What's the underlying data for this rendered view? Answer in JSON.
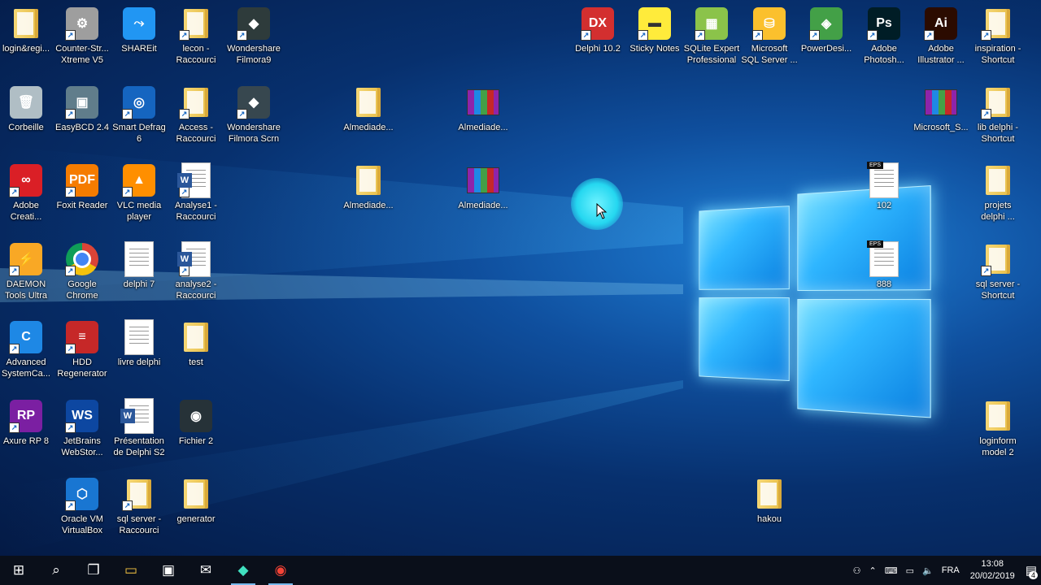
{
  "desktop": {
    "icons": [
      {
        "id": "login",
        "label": "login&regi...",
        "kind": "folder",
        "shortcut": false
      },
      {
        "id": "counter-strike",
        "label": "Counter-Str...\nXtreme V5",
        "kind": "app",
        "color": "#9e9e9e",
        "glyph": "⚙",
        "shortcut": true
      },
      {
        "id": "shareit",
        "label": "SHAREit",
        "kind": "app",
        "color": "#2196f3",
        "glyph": "⤳",
        "shortcut": false
      },
      {
        "id": "lecon",
        "label": "lecon -\nRaccourci",
        "kind": "folder",
        "shortcut": true
      },
      {
        "id": "filmora9",
        "label": "Wondershare\nFilmora9",
        "kind": "app",
        "color": "#2e3b3b",
        "glyph": "◆",
        "shortcut": true
      },
      {
        "id": "corbeille",
        "label": "Corbeille",
        "kind": "app",
        "color": "#b0bec5",
        "glyph": "🗑",
        "shortcut": false
      },
      {
        "id": "easybcd",
        "label": "EasyBCD 2.4",
        "kind": "app",
        "color": "#607d8b",
        "glyph": "▣",
        "shortcut": true
      },
      {
        "id": "smartdefrag",
        "label": "Smart Defrag\n6",
        "kind": "app",
        "color": "#1565c0",
        "glyph": "◎",
        "shortcut": true
      },
      {
        "id": "access",
        "label": "Access -\nRaccourci",
        "kind": "folder",
        "shortcut": true
      },
      {
        "id": "filmora-scrn",
        "label": "Wondershare\nFilmora Scrn",
        "kind": "app",
        "color": "#37474f",
        "glyph": "◆",
        "shortcut": true
      },
      {
        "id": "adobe-cc",
        "label": "Adobe\nCreati...",
        "kind": "app",
        "color": "#da1f26",
        "glyph": "∞",
        "shortcut": true
      },
      {
        "id": "foxit",
        "label": "Foxit Reader",
        "kind": "app",
        "color": "#f57c00",
        "glyph": "PDF",
        "shortcut": true
      },
      {
        "id": "vlc",
        "label": "VLC media\nplayer",
        "kind": "app",
        "color": "#ff8f00",
        "glyph": "▲",
        "shortcut": true
      },
      {
        "id": "analyse1",
        "label": "Analyse1 -\nRaccourci",
        "kind": "word",
        "shortcut": true
      },
      {
        "id": "daemon",
        "label": "DAEMON\nTools Ultra",
        "kind": "app",
        "color": "#f9a825",
        "glyph": "⚡",
        "shortcut": true
      },
      {
        "id": "chrome",
        "label": "Google\nChrome",
        "kind": "chrome",
        "shortcut": true
      },
      {
        "id": "delphi7",
        "label": "delphi 7",
        "kind": "doc",
        "shortcut": false
      },
      {
        "id": "analyse2",
        "label": "analyse2 -\nRaccourci",
        "kind": "word",
        "shortcut": true
      },
      {
        "id": "advsystemcare",
        "label": "Advanced\nSystemCa...",
        "kind": "app",
        "color": "#1e88e5",
        "glyph": "C",
        "shortcut": true
      },
      {
        "id": "hdd-regen",
        "label": "HDD\nRegenerator",
        "kind": "app",
        "color": "#c62828",
        "glyph": "≡",
        "shortcut": true
      },
      {
        "id": "livre-delphi",
        "label": "livre delphi",
        "kind": "doc",
        "shortcut": false
      },
      {
        "id": "test",
        "label": "test",
        "kind": "folder",
        "shortcut": false
      },
      {
        "id": "axure",
        "label": "Axure RP 8",
        "kind": "app",
        "color": "#7b1fa2",
        "glyph": "RP",
        "shortcut": true
      },
      {
        "id": "webstorm",
        "label": "JetBrains\nWebStor...",
        "kind": "app",
        "color": "#0d47a1",
        "glyph": "WS",
        "shortcut": true
      },
      {
        "id": "presentation",
        "label": "Présentation\nde Delphi S2",
        "kind": "word",
        "shortcut": false
      },
      {
        "id": "fichier2",
        "label": "Fichier 2",
        "kind": "app",
        "color": "#263238",
        "glyph": "◉",
        "shortcut": false
      },
      {
        "id": "virtualbox",
        "label": "Oracle VM\nVirtualBox",
        "kind": "app",
        "color": "#1976d2",
        "glyph": "⬡",
        "shortcut": true
      },
      {
        "id": "sqlserver-racc",
        "label": "sql server -\nRaccourci",
        "kind": "folder",
        "shortcut": true
      },
      {
        "id": "generator",
        "label": "generator",
        "kind": "folder",
        "shortcut": false
      },
      {
        "id": "almediade1",
        "label": "Almediade...",
        "kind": "folder",
        "shortcut": false
      },
      {
        "id": "almediade2",
        "label": "Almediade...",
        "kind": "rar",
        "shortcut": false
      },
      {
        "id": "almediade3",
        "label": "Almediade...",
        "kind": "folder",
        "shortcut": false
      },
      {
        "id": "almediade4",
        "label": "Almediade...",
        "kind": "rar",
        "shortcut": false
      },
      {
        "id": "delphi102",
        "label": "Delphi 10.2",
        "kind": "app",
        "color": "#d32f2f",
        "glyph": "DX",
        "shortcut": true
      },
      {
        "id": "stickynotes",
        "label": "Sticky Notes",
        "kind": "app",
        "color": "#ffeb3b",
        "glyph": "▬",
        "shortcut": true
      },
      {
        "id": "sqlite-expert",
        "label": "SQLite Expert\nProfessional",
        "kind": "app",
        "color": "#8bc34a",
        "glyph": "▦",
        "shortcut": true
      },
      {
        "id": "ms-sql",
        "label": "Microsoft\nSQL Server ...",
        "kind": "app",
        "color": "#fbc02d",
        "glyph": "⛁",
        "shortcut": true
      },
      {
        "id": "powerdesi",
        "label": "PowerDesi...",
        "kind": "app",
        "color": "#43a047",
        "glyph": "◈",
        "shortcut": true
      },
      {
        "id": "photoshop",
        "label": "Adobe\nPhotosh...",
        "kind": "app",
        "color": "#001d26",
        "glyph": "Ps",
        "shortcut": true
      },
      {
        "id": "illustrator",
        "label": "Adobe\nIllustrator ...",
        "kind": "app",
        "color": "#2b0b00",
        "glyph": "Ai",
        "shortcut": true
      },
      {
        "id": "inspiration",
        "label": "inspiration -\nShortcut",
        "kind": "folder",
        "shortcut": true
      },
      {
        "id": "microsoft-s",
        "label": "Microsoft_S...",
        "kind": "rar",
        "shortcut": false
      },
      {
        "id": "lib-delphi",
        "label": "lib delphi -\nShortcut",
        "kind": "folder",
        "shortcut": true
      },
      {
        "id": "eps102",
        "label": "102",
        "kind": "eps",
        "shortcut": false
      },
      {
        "id": "projets-delphi",
        "label": "projets\ndelphi ...",
        "kind": "folder",
        "shortcut": false
      },
      {
        "id": "eps888",
        "label": "888",
        "kind": "eps",
        "shortcut": false
      },
      {
        "id": "sqlserver-shortcut",
        "label": "sql server -\nShortcut",
        "kind": "folder",
        "shortcut": true
      },
      {
        "id": "loginform",
        "label": "loginform\nmodel 2",
        "kind": "folder",
        "shortcut": false
      },
      {
        "id": "hakou",
        "label": "hakou",
        "kind": "folder",
        "shortcut": false
      }
    ]
  },
  "taskbar": {
    "apps": [
      {
        "id": "start",
        "icon": "windows-logo-icon",
        "glyph": "⊞",
        "active": false
      },
      {
        "id": "search",
        "icon": "search-icon",
        "glyph": "⌕",
        "active": false
      },
      {
        "id": "taskview",
        "icon": "task-view-icon",
        "glyph": "❐",
        "active": false
      },
      {
        "id": "explorer",
        "icon": "file-explorer-icon",
        "glyph": "▭",
        "active": false
      },
      {
        "id": "store",
        "icon": "store-icon",
        "glyph": "▣",
        "active": false
      },
      {
        "id": "mail",
        "icon": "mail-icon",
        "glyph": "✉",
        "active": false
      },
      {
        "id": "filmora",
        "icon": "filmora-icon",
        "glyph": "◆",
        "active": true
      },
      {
        "id": "chrome",
        "icon": "chrome-icon",
        "glyph": "◉",
        "active": true
      }
    ],
    "tray": {
      "language": "FRA",
      "time": "13:08",
      "date": "20/02/2019",
      "notifications": "4"
    }
  }
}
